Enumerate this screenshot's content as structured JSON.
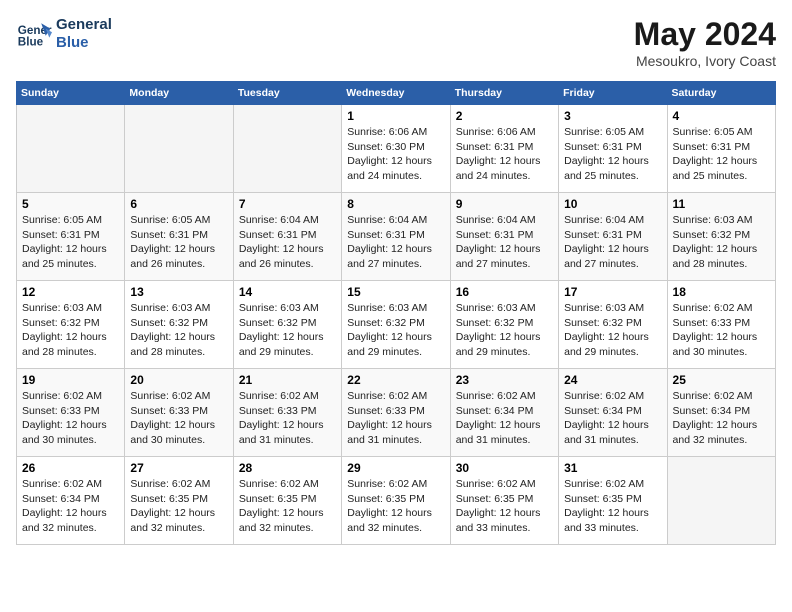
{
  "header": {
    "logo_line1": "General",
    "logo_line2": "Blue",
    "month_year": "May 2024",
    "location": "Mesoukro, Ivory Coast"
  },
  "days_of_week": [
    "Sunday",
    "Monday",
    "Tuesday",
    "Wednesday",
    "Thursday",
    "Friday",
    "Saturday"
  ],
  "weeks": [
    [
      {
        "day": "",
        "info": ""
      },
      {
        "day": "",
        "info": ""
      },
      {
        "day": "",
        "info": ""
      },
      {
        "day": "1",
        "info": "Sunrise: 6:06 AM\nSunset: 6:30 PM\nDaylight: 12 hours\nand 24 minutes."
      },
      {
        "day": "2",
        "info": "Sunrise: 6:06 AM\nSunset: 6:31 PM\nDaylight: 12 hours\nand 24 minutes."
      },
      {
        "day": "3",
        "info": "Sunrise: 6:05 AM\nSunset: 6:31 PM\nDaylight: 12 hours\nand 25 minutes."
      },
      {
        "day": "4",
        "info": "Sunrise: 6:05 AM\nSunset: 6:31 PM\nDaylight: 12 hours\nand 25 minutes."
      }
    ],
    [
      {
        "day": "5",
        "info": "Sunrise: 6:05 AM\nSunset: 6:31 PM\nDaylight: 12 hours\nand 25 minutes."
      },
      {
        "day": "6",
        "info": "Sunrise: 6:05 AM\nSunset: 6:31 PM\nDaylight: 12 hours\nand 26 minutes."
      },
      {
        "day": "7",
        "info": "Sunrise: 6:04 AM\nSunset: 6:31 PM\nDaylight: 12 hours\nand 26 minutes."
      },
      {
        "day": "8",
        "info": "Sunrise: 6:04 AM\nSunset: 6:31 PM\nDaylight: 12 hours\nand 27 minutes."
      },
      {
        "day": "9",
        "info": "Sunrise: 6:04 AM\nSunset: 6:31 PM\nDaylight: 12 hours\nand 27 minutes."
      },
      {
        "day": "10",
        "info": "Sunrise: 6:04 AM\nSunset: 6:31 PM\nDaylight: 12 hours\nand 27 minutes."
      },
      {
        "day": "11",
        "info": "Sunrise: 6:03 AM\nSunset: 6:32 PM\nDaylight: 12 hours\nand 28 minutes."
      }
    ],
    [
      {
        "day": "12",
        "info": "Sunrise: 6:03 AM\nSunset: 6:32 PM\nDaylight: 12 hours\nand 28 minutes."
      },
      {
        "day": "13",
        "info": "Sunrise: 6:03 AM\nSunset: 6:32 PM\nDaylight: 12 hours\nand 28 minutes."
      },
      {
        "day": "14",
        "info": "Sunrise: 6:03 AM\nSunset: 6:32 PM\nDaylight: 12 hours\nand 29 minutes."
      },
      {
        "day": "15",
        "info": "Sunrise: 6:03 AM\nSunset: 6:32 PM\nDaylight: 12 hours\nand 29 minutes."
      },
      {
        "day": "16",
        "info": "Sunrise: 6:03 AM\nSunset: 6:32 PM\nDaylight: 12 hours\nand 29 minutes."
      },
      {
        "day": "17",
        "info": "Sunrise: 6:03 AM\nSunset: 6:32 PM\nDaylight: 12 hours\nand 29 minutes."
      },
      {
        "day": "18",
        "info": "Sunrise: 6:02 AM\nSunset: 6:33 PM\nDaylight: 12 hours\nand 30 minutes."
      }
    ],
    [
      {
        "day": "19",
        "info": "Sunrise: 6:02 AM\nSunset: 6:33 PM\nDaylight: 12 hours\nand 30 minutes."
      },
      {
        "day": "20",
        "info": "Sunrise: 6:02 AM\nSunset: 6:33 PM\nDaylight: 12 hours\nand 30 minutes."
      },
      {
        "day": "21",
        "info": "Sunrise: 6:02 AM\nSunset: 6:33 PM\nDaylight: 12 hours\nand 31 minutes."
      },
      {
        "day": "22",
        "info": "Sunrise: 6:02 AM\nSunset: 6:33 PM\nDaylight: 12 hours\nand 31 minutes."
      },
      {
        "day": "23",
        "info": "Sunrise: 6:02 AM\nSunset: 6:34 PM\nDaylight: 12 hours\nand 31 minutes."
      },
      {
        "day": "24",
        "info": "Sunrise: 6:02 AM\nSunset: 6:34 PM\nDaylight: 12 hours\nand 31 minutes."
      },
      {
        "day": "25",
        "info": "Sunrise: 6:02 AM\nSunset: 6:34 PM\nDaylight: 12 hours\nand 32 minutes."
      }
    ],
    [
      {
        "day": "26",
        "info": "Sunrise: 6:02 AM\nSunset: 6:34 PM\nDaylight: 12 hours\nand 32 minutes."
      },
      {
        "day": "27",
        "info": "Sunrise: 6:02 AM\nSunset: 6:35 PM\nDaylight: 12 hours\nand 32 minutes."
      },
      {
        "day": "28",
        "info": "Sunrise: 6:02 AM\nSunset: 6:35 PM\nDaylight: 12 hours\nand 32 minutes."
      },
      {
        "day": "29",
        "info": "Sunrise: 6:02 AM\nSunset: 6:35 PM\nDaylight: 12 hours\nand 32 minutes."
      },
      {
        "day": "30",
        "info": "Sunrise: 6:02 AM\nSunset: 6:35 PM\nDaylight: 12 hours\nand 33 minutes."
      },
      {
        "day": "31",
        "info": "Sunrise: 6:02 AM\nSunset: 6:35 PM\nDaylight: 12 hours\nand 33 minutes."
      },
      {
        "day": "",
        "info": ""
      }
    ]
  ]
}
